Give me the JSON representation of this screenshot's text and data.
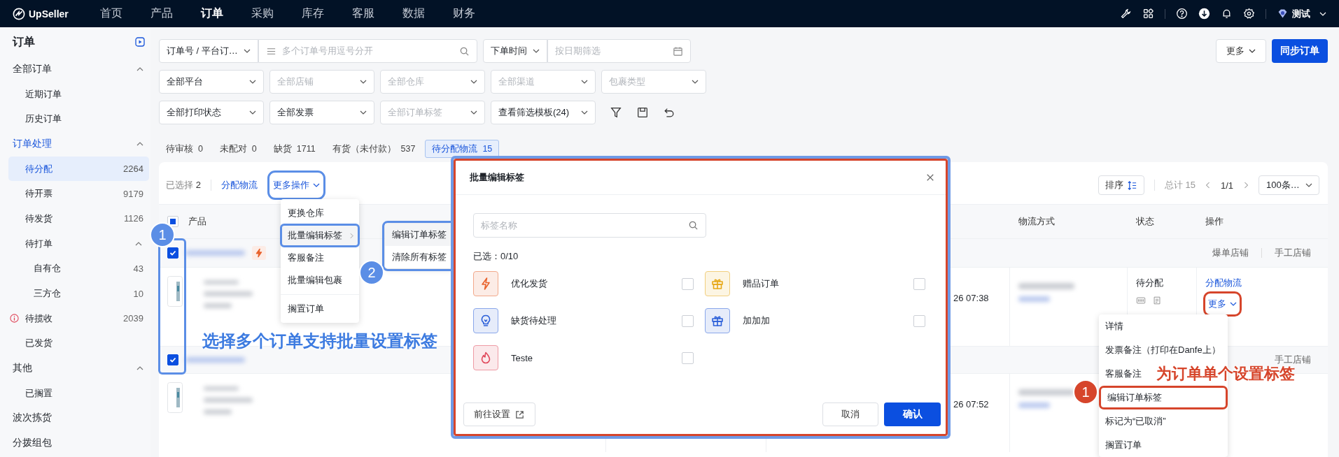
{
  "top_nav": {
    "logo": "UpSeller",
    "items": [
      {
        "label": "首页",
        "selected": false
      },
      {
        "label": "产品",
        "selected": false
      },
      {
        "label": "订单",
        "selected": true
      },
      {
        "label": "采购",
        "selected": false
      },
      {
        "label": "库存",
        "selected": false
      },
      {
        "label": "客服",
        "selected": false
      },
      {
        "label": "数据",
        "selected": false
      },
      {
        "label": "财务",
        "selected": false
      }
    ],
    "user": "测试"
  },
  "sidebar": {
    "title": "订单",
    "items": [
      {
        "label": "全部订单",
        "selected": false,
        "expanded": true,
        "children": [
          {
            "label": "近期订单",
            "selected": false
          },
          {
            "label": "历史订单",
            "selected": false
          }
        ]
      },
      {
        "label": "订单处理",
        "selected": false,
        "expanded": true,
        "children": [
          {
            "label": "待分配",
            "count": "2264",
            "selected": true
          },
          {
            "label": "待开票",
            "count": "9179",
            "selected": false
          },
          {
            "label": "待发货",
            "count": "1126",
            "selected": false
          },
          {
            "label": "待打单",
            "selected": false,
            "expanded": true,
            "children": [
              {
                "label": "自有仓",
                "count": "43",
                "selected": false
              },
              {
                "label": "三方仓",
                "count": "10",
                "selected": false
              }
            ]
          },
          {
            "label": "待揽收",
            "count": "2039",
            "selected": false,
            "warning": true
          },
          {
            "label": "已发货",
            "selected": false
          }
        ]
      },
      {
        "label": "其他",
        "selected": false,
        "expanded": true,
        "children": [
          {
            "label": "已搁置",
            "selected": false
          }
        ]
      },
      {
        "label": "波次拣货",
        "selected": false
      },
      {
        "label": "分拨组包",
        "selected": false
      }
    ]
  },
  "filters": [
    [
      {
        "kind": "select",
        "value": "订单号 / 平台订…"
      },
      {
        "kind": "search",
        "placeholder": "多个订单号用逗号分开"
      },
      {
        "kind": "select",
        "value": "下单时间"
      },
      {
        "kind": "date",
        "placeholder": "按日期筛选"
      }
    ],
    [
      {
        "kind": "select",
        "value": "全部平台"
      },
      {
        "kind": "select",
        "placeholder": "全部店铺"
      },
      {
        "kind": "select",
        "placeholder": "全部仓库"
      },
      {
        "kind": "select",
        "placeholder": "全部渠道"
      },
      {
        "kind": "select",
        "placeholder": "包裹类型"
      }
    ],
    [
      {
        "kind": "select",
        "value": "全部打印状态"
      },
      {
        "kind": "select",
        "value": "全部发票"
      },
      {
        "kind": "select",
        "placeholder": "全部订单标签"
      },
      {
        "kind": "select",
        "value": "查看筛选模板(24)"
      }
    ]
  ],
  "header_buttons": {
    "more": "更多",
    "sync": "同步订单"
  },
  "status_tabs": [
    {
      "label": "待审核",
      "count": "0",
      "selected": false
    },
    {
      "label": "未配对",
      "count": "0",
      "selected": false
    },
    {
      "label": "缺货",
      "count": "1711",
      "selected": false
    },
    {
      "label": "有货（未付款）",
      "count": "537",
      "selected": false
    },
    {
      "label": "待分配物流",
      "count": "15",
      "selected": true
    }
  ],
  "toolbar": {
    "selected_text": "已选择",
    "selected_count": "2",
    "assign": "分配物流",
    "more_actions": "更多操作",
    "sort": "排序",
    "total": "总计 15",
    "page": "1/1",
    "page_size": "100条…"
  },
  "table": {
    "select_all": {
      "indeterminate": true
    },
    "columns": [
      {
        "label": "产品"
      },
      {
        "label": "物流方式"
      },
      {
        "label": "状态"
      },
      {
        "label": "操作"
      }
    ]
  },
  "orders": [
    {
      "checked": true,
      "tags": [
        {
          "kind": "bolt",
          "color": "#e8622c"
        }
      ],
      "shops": [
        "爆单店铺",
        "手工店铺"
      ],
      "time": "26 07:38",
      "status": "待分配",
      "actions": {
        "assign": "分配物流",
        "more": "更多"
      }
    },
    {
      "checked": true,
      "shops": [
        "手工店铺"
      ],
      "time": "26 07:52"
    }
  ],
  "bulk_menu": {
    "items": [
      {
        "label": "更换仓库",
        "selected": false,
        "submenu": false,
        "separated": false
      },
      {
        "label": "批量编辑标签",
        "selected": true,
        "submenu": true,
        "separated": false
      },
      {
        "label": "客服备注",
        "selected": false,
        "submenu": false,
        "separated": false
      },
      {
        "label": "批量编辑包裹",
        "selected": false,
        "submenu": false,
        "separated": false
      },
      {
        "label": "搁置订单",
        "selected": false,
        "submenu": false,
        "separated": true
      }
    ],
    "submenu": [
      {
        "label": "编辑订单标签",
        "selected": true
      },
      {
        "label": "清除所有标签",
        "selected": false
      }
    ]
  },
  "dialog": {
    "title": "批量编辑标签",
    "search_placeholder": "标签名称",
    "selected_text": "已选：0/10",
    "tags": [
      {
        "name": "优化发货",
        "kind": "bolt",
        "color": "#e8622c",
        "checked": false
      },
      {
        "name": "赠品订单",
        "kind": "gift",
        "color": "#e6a817",
        "checked": false
      },
      {
        "name": "缺货待处理",
        "kind": "bulb",
        "color": "#2b5fd9",
        "checked": false
      },
      {
        "name": "加加加",
        "kind": "gift",
        "color": "#2b5fd9",
        "checked": false
      },
      {
        "name": "Teste",
        "kind": "flame",
        "color": "#e0475a",
        "checked": false
      }
    ],
    "settings": "前往设置",
    "cancel": "取消",
    "confirm": "确认"
  },
  "row_menu": [
    {
      "label": "详情",
      "selected": false
    },
    {
      "label": "发票备注（打印在Danfe上）",
      "selected": false
    },
    {
      "label": "客服备注",
      "selected": false
    },
    {
      "label": "编辑订单标签",
      "selected": true
    },
    {
      "label": "标记为“已取消”",
      "selected": false
    },
    {
      "label": "搁置订单",
      "selected": false
    }
  ],
  "annotations": {
    "badges": [
      {
        "label": "1",
        "color": "#5b8ee6"
      },
      {
        "label": "2",
        "color": "#5b8ee6"
      },
      {
        "label": "1",
        "color": "#d6452b"
      }
    ],
    "notes": [
      {
        "text": "选择多个订单支持批量设置标签",
        "color": "#3d7be0"
      },
      {
        "text": "为订单单个设置标签",
        "color": "#d6452b"
      }
    ]
  }
}
